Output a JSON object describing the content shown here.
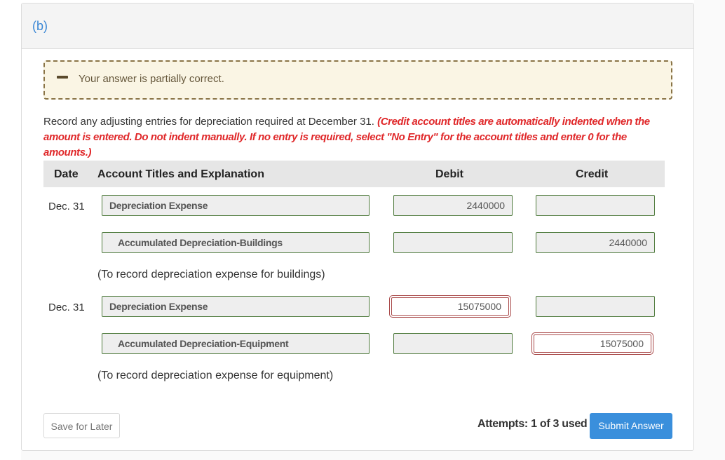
{
  "part_label": "(b)",
  "alert": {
    "icon": "minus-icon",
    "text": "Your answer is partially correct."
  },
  "instructions": {
    "main": "Record any adjusting entries for depreciation required at December 31. ",
    "note": "(Credit account titles are automatically indented when the amount is entered. Do not indent manually. If no entry is required, select \"No Entry\" for the account titles and enter 0 for the amounts.)"
  },
  "table": {
    "headers": {
      "date": "Date",
      "account": "Account Titles and Explanation",
      "debit": "Debit",
      "credit": "Credit"
    },
    "entries": [
      {
        "date": "Dec. 31",
        "lines": [
          {
            "account": "Depreciation Expense",
            "debit": "2440000",
            "credit": "",
            "debit_status": "correct",
            "credit_status": "correct"
          },
          {
            "account": "Accumulated Depreciation-Buildings",
            "debit": "",
            "credit": "2440000",
            "debit_status": "correct",
            "credit_status": "correct"
          }
        ],
        "explanation": "(To record depreciation expense for buildings)"
      },
      {
        "date": "Dec. 31",
        "lines": [
          {
            "account": "Depreciation Expense",
            "debit": "15075000",
            "credit": "",
            "debit_status": "incorrect",
            "credit_status": "correct"
          },
          {
            "account": "Accumulated Depreciation-Equipment",
            "debit": "",
            "credit": "15075000",
            "debit_status": "correct",
            "credit_status": "incorrect"
          }
        ],
        "explanation": "(To record depreciation expense for equipment)"
      }
    ]
  },
  "footer": {
    "save_label": "Save for Later",
    "attempts": "Attempts: 1 of 3 used",
    "submit_label": "Submit Answer"
  },
  "colors": {
    "accent": "#3a8fdc",
    "correct_border": "#4e7a3c",
    "incorrect_border": "#a94a4a",
    "note_red": "#e0282a"
  }
}
